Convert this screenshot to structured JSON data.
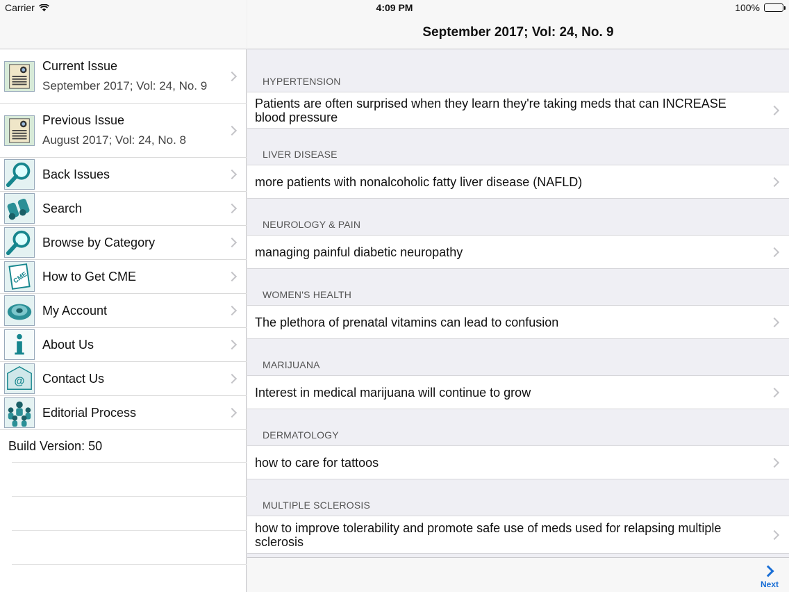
{
  "status_bar": {
    "carrier": "Carrier",
    "time": "4:09 PM",
    "battery": "100%"
  },
  "master": {
    "menu": [
      {
        "label": "Current Issue",
        "sub": "September 2017; Vol: 24, No. 9",
        "icon": "issue-cover-icon"
      },
      {
        "label": "Previous Issue",
        "sub": "August 2017; Vol: 24, No. 8",
        "icon": "issue-cover-icon"
      },
      {
        "label": "Back Issues",
        "icon": "magnifier-icon"
      },
      {
        "label": "Search",
        "icon": "binoculars-icon"
      },
      {
        "label": "Browse by Category",
        "icon": "magnifier-icon"
      },
      {
        "label": "How to Get CME",
        "icon": "cme-icon"
      },
      {
        "label": "My Account",
        "icon": "gear-icon"
      },
      {
        "label": "About Us",
        "icon": "info-icon"
      },
      {
        "label": "Contact Us",
        "icon": "email-icon"
      },
      {
        "label": "Editorial Process",
        "icon": "people-icon"
      }
    ],
    "build_version": "Build Version: 50"
  },
  "detail": {
    "title": "September 2017; Vol: 24, No. 9",
    "sections": [
      {
        "header": "HYPERTENSION",
        "item": "Patients are often surprised when they learn they're taking meds that can INCREASE blood pressure"
      },
      {
        "header": "LIVER DISEASE",
        "item": "more patients with nonalcoholic fatty liver disease (NAFLD)"
      },
      {
        "header": "NEUROLOGY & PAIN",
        "item": "managing painful diabetic neuropathy"
      },
      {
        "header": "WOMEN'S HEALTH",
        "item": "The plethora of prenatal vitamins can lead to confusion"
      },
      {
        "header": "MARIJUANA",
        "item": "Interest in medical marijuana will continue to grow"
      },
      {
        "header": "DERMATOLOGY",
        "item": "how to care for tattoos"
      },
      {
        "header": "MULTIPLE SCLEROSIS",
        "item": "how to improve tolerability and promote safe use of meds used for relapsing multiple sclerosis"
      }
    ],
    "toolbar": {
      "next_label": "Next"
    }
  },
  "colors": {
    "accent": "#1a6fd6",
    "separator": "#c8c8cc",
    "background": "#efeff4"
  }
}
